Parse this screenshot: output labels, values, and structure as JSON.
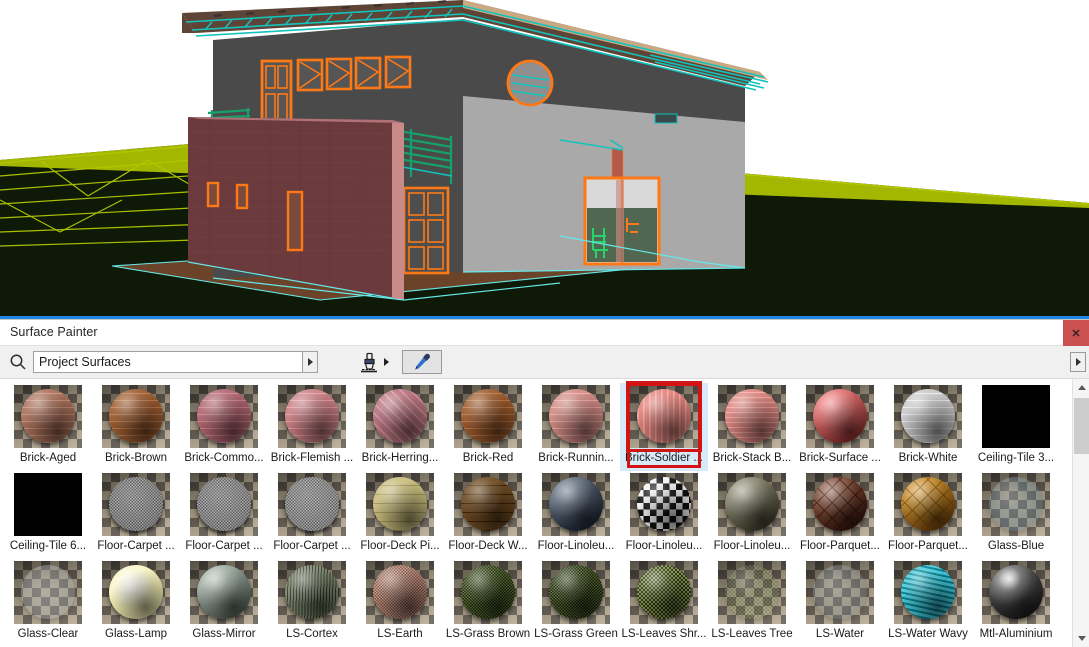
{
  "viewport": {
    "name": "3d-model-viewport",
    "description": "Architectural 3D model of a single-storey house with shed roof, brick garden wall, orange-highlighted windows and doors, teal railings, dark green ground plane and yellow site contour lines.",
    "colors": {
      "sky": "#ffffff",
      "ground": "#0e1a07",
      "ground_lines": "#b4c800",
      "stucco_wall": "#a9a9a9",
      "dark_wall": "#4a4a4a",
      "brick_wall": "#6b3a3d",
      "roof_fascia": "#5e4436",
      "roof_wood": "#c9a882",
      "highlight_orange": "#ff7816",
      "highlight_teal": "#12c3bd",
      "highlight_green": "#17a06a",
      "deck": "#6b4328",
      "selection_line": "#1e88e5"
    }
  },
  "panel": {
    "title": "Surface Painter",
    "close_label": "✕",
    "close_icon": "close-icon"
  },
  "toolbar": {
    "search_icon": "search-icon",
    "search_value": "Project Surfaces",
    "search_placeholder": "Project Surfaces",
    "dropdown_icon": "chevron-right-icon",
    "brush_icon": "paintbrush-icon",
    "brush_dropdown_icon": "chevron-right-icon",
    "picker_icon": "eyedropper-icon",
    "overflow_icon": "chevron-right-icon"
  },
  "scrollbar": {
    "up_icon": "chevron-up-icon",
    "down_icon": "chevron-down-icon"
  },
  "grid": {
    "selected_index": 7,
    "items": [
      {
        "label": "Brick-Aged",
        "color": "#a9705a",
        "style": "brick",
        "texture": "running-bond"
      },
      {
        "label": "Brick-Brown",
        "color": "#9c5c30",
        "style": "brick",
        "texture": "running-bond"
      },
      {
        "label": "Brick-Commo...",
        "color": "#b06570",
        "style": "brick",
        "texture": "running-bond"
      },
      {
        "label": "Brick-Flemish ...",
        "color": "#c97f84",
        "style": "brick",
        "texture": "running-bond"
      },
      {
        "label": "Brick-Herring...",
        "color": "#b7737e",
        "style": "brick",
        "texture": "herringbone"
      },
      {
        "label": "Brick-Red",
        "color": "#9c5a2c",
        "style": "brick",
        "texture": "running-bond"
      },
      {
        "label": "Brick-Runnin...",
        "color": "#d08a84",
        "style": "brick",
        "texture": "running-bond"
      },
      {
        "label": "Brick-Soldier ...",
        "color": "#dd837c",
        "style": "brick",
        "texture": "soldier"
      },
      {
        "label": "Brick-Stack B...",
        "color": "#d9857f",
        "style": "brick",
        "texture": "stack"
      },
      {
        "label": "Brick-Surface ...",
        "color": "#cf6363",
        "style": "plain",
        "texture": "none"
      },
      {
        "label": "Brick-White",
        "color": "#c9c9c9",
        "style": "brick",
        "texture": "running-bond"
      },
      {
        "label": "Ceiling-Tile 3...",
        "color": "#000000",
        "style": "solid",
        "texture": "none"
      },
      {
        "label": "Ceiling-Tile 6...",
        "color": "#000000",
        "style": "solid",
        "texture": "none"
      },
      {
        "label": "Floor-Carpet ...",
        "color": "#878787",
        "style": "disc",
        "texture": "noise"
      },
      {
        "label": "Floor-Carpet ...",
        "color": "#8a8a8a",
        "style": "disc",
        "texture": "noise"
      },
      {
        "label": "Floor-Carpet ...",
        "color": "#8d8d8d",
        "style": "disc",
        "texture": "noise"
      },
      {
        "label": "Floor-Deck Pi...",
        "color": "#c9bd7e",
        "style": "plain",
        "texture": "bands"
      },
      {
        "label": "Floor-Deck W...",
        "color": "#6d4a22",
        "style": "plain",
        "texture": "bands"
      },
      {
        "label": "Floor-Linoleu...",
        "color": "#505b6b",
        "style": "plain",
        "texture": "none"
      },
      {
        "label": "Floor-Linoleu...",
        "color": "#e8e8e8",
        "style": "checker",
        "texture": "checker"
      },
      {
        "label": "Floor-Linoleu...",
        "color": "#787560",
        "style": "plain",
        "texture": "none"
      },
      {
        "label": "Floor-Parquet...",
        "color": "#6d3f2e",
        "style": "plain",
        "texture": "parquet"
      },
      {
        "label": "Floor-Parquet...",
        "color": "#b07a22",
        "style": "plain",
        "texture": "parquet"
      },
      {
        "label": "Glass-Blue",
        "color": "#7fa0b5",
        "style": "glass",
        "texture": "none"
      },
      {
        "label": "Glass-Clear",
        "color": "#cfd6da",
        "style": "glass",
        "texture": "none"
      },
      {
        "label": "Glass-Lamp",
        "color": "#f7f2b8",
        "style": "glow",
        "texture": "none"
      },
      {
        "label": "Glass-Mirror",
        "color": "#8d9a90",
        "style": "plain",
        "texture": "none"
      },
      {
        "label": "LS-Cortex",
        "color": "#5c6550",
        "style": "plain",
        "texture": "fibrous"
      },
      {
        "label": "LS-Earth",
        "color": "#a4796a",
        "style": "plain",
        "texture": "noise"
      },
      {
        "label": "LS-Grass Brown",
        "color": "#3f5022",
        "style": "plain",
        "texture": "noise"
      },
      {
        "label": "LS-Grass Green",
        "color": "#3d4a21",
        "style": "plain",
        "texture": "noise"
      },
      {
        "label": "LS-Leaves Shr...",
        "color": "#54602c",
        "style": "plain",
        "texture": "leaves"
      },
      {
        "label": "LS-Leaves Tree",
        "color": "#6d7a45",
        "style": "glass",
        "texture": "leaves"
      },
      {
        "label": "LS-Water",
        "color": "#9aa7ad",
        "style": "glass",
        "texture": "none"
      },
      {
        "label": "LS-Water Wavy",
        "color": "#25a7b8",
        "style": "plain",
        "texture": "waves"
      },
      {
        "label": "Mtl-Aluminium",
        "color": "#3a3a3a",
        "style": "metal",
        "texture": "none"
      }
    ]
  }
}
